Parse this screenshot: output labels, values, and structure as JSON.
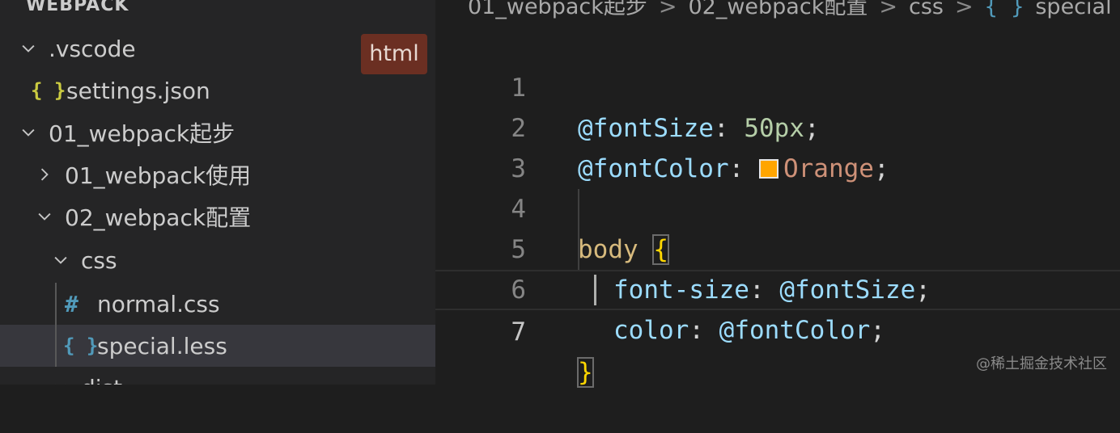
{
  "sidebar": {
    "section_title": "WEBPACK",
    "items": [
      {
        "label": ".vscode",
        "type": "folder",
        "expanded": true
      },
      {
        "label": "settings.json",
        "type": "json-file",
        "icon": "{ }"
      },
      {
        "label": "01_webpack起步",
        "type": "folder",
        "expanded": true
      },
      {
        "label": "01_webpack使用",
        "type": "folder",
        "expanded": false
      },
      {
        "label": "02_webpack配置",
        "type": "folder",
        "expanded": true
      },
      {
        "label": "css",
        "type": "folder",
        "expanded": true
      },
      {
        "label": "normal.css",
        "type": "css-file",
        "icon": "#"
      },
      {
        "label": "special.less",
        "type": "less-file",
        "icon": "{ }",
        "selected": true
      },
      {
        "label": "dist",
        "type": "folder",
        "expanded": true
      }
    ]
  },
  "badge": {
    "label": "html"
  },
  "breadcrumb": {
    "parts": [
      "01_webpack起步",
      "02_webpack配置",
      "css",
      "special"
    ],
    "separator": ">",
    "file_icon": "{ }"
  },
  "editor": {
    "line_numbers": [
      "1",
      "2",
      "3",
      "4",
      "5",
      "6",
      "7"
    ],
    "current_line": 7,
    "tokens": {
      "l1_var": "@fontSize",
      "l1_colon": ": ",
      "l1_value": "50px",
      "l1_semi": ";",
      "l2_var": "@fontColor",
      "l2_colon": ": ",
      "l2_value": "Orange",
      "l2_semi": ";",
      "l4_selector": "body",
      "l4_brace": "{",
      "l5_prop": "font-size",
      "l5_colon": ": ",
      "l5_value": "@fontSize",
      "l5_semi": ";",
      "l6_prop": "color",
      "l6_colon": ": ",
      "l6_value": "@fontColor",
      "l6_semi": ";",
      "l7_brace": "}"
    }
  },
  "watermark": "@稀土掘金技术社区",
  "colors": {
    "background": "#1e1e1e",
    "sidebar": "#252526",
    "selected_row": "#37373d",
    "variable": "#9cdcfe",
    "number": "#b5cea8",
    "string": "#ce9178",
    "selector": "#d7ba7d",
    "brace": "#ffd700",
    "color_swatch": "#ffa500",
    "badge": "#6b2f22"
  }
}
